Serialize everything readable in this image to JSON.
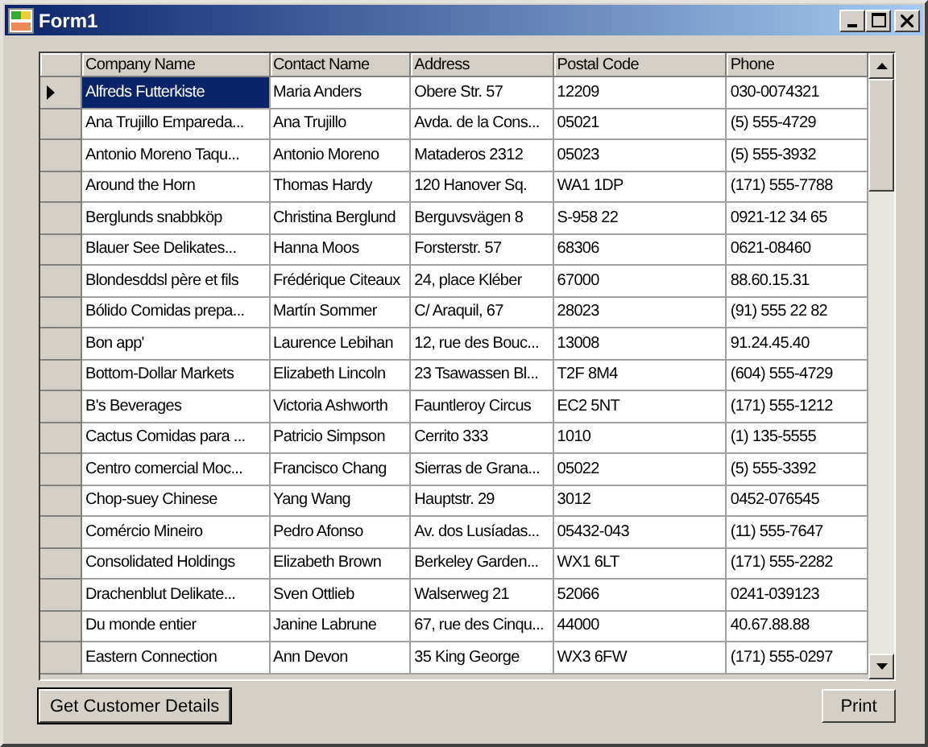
{
  "window": {
    "title": "Form1"
  },
  "table": {
    "columns": [
      "Company Name",
      "Contact Name",
      "Address",
      "Postal Code",
      "Phone"
    ],
    "rows": [
      {
        "current": true,
        "cells": [
          "Alfreds Futterkiste",
          "Maria Anders",
          "Obere Str. 57",
          "12209",
          "030-0074321"
        ]
      },
      {
        "current": false,
        "cells": [
          "Ana Trujillo Empareda...",
          "Ana Trujillo",
          "Avda. de la Cons...",
          "05021",
          "(5) 555-4729"
        ]
      },
      {
        "current": false,
        "cells": [
          "Antonio Moreno Taqu...",
          "Antonio Moreno",
          "Mataderos  2312",
          "05023",
          "(5) 555-3932"
        ]
      },
      {
        "current": false,
        "cells": [
          "Around the Horn",
          "Thomas Hardy",
          "120 Hanover Sq.",
          "WA1 1DP",
          "(171) 555-7788"
        ]
      },
      {
        "current": false,
        "cells": [
          "Berglunds snabbköp",
          "Christina Berglund",
          "Berguvsvägen  8",
          "S-958 22",
          "0921-12 34 65"
        ]
      },
      {
        "current": false,
        "cells": [
          "Blauer See Delikates...",
          "Hanna Moos",
          "Forsterstr. 57",
          "68306",
          "0621-08460"
        ]
      },
      {
        "current": false,
        "cells": [
          "Blondesddsl père et fils",
          "Frédérique Citeaux",
          "24, place Kléber",
          "67000",
          "88.60.15.31"
        ]
      },
      {
        "current": false,
        "cells": [
          "Bólido Comidas prepa...",
          "Martín Sommer",
          "C/ Araquil, 67",
          "28023",
          "(91) 555 22 82"
        ]
      },
      {
        "current": false,
        "cells": [
          "Bon app'",
          "Laurence Lebihan",
          "12, rue des Bouc...",
          "13008",
          "91.24.45.40"
        ]
      },
      {
        "current": false,
        "cells": [
          "Bottom-Dollar Markets",
          "Elizabeth Lincoln",
          "23 Tsawassen Bl...",
          "T2F 8M4",
          "(604) 555-4729"
        ]
      },
      {
        "current": false,
        "cells": [
          "B's Beverages",
          "Victoria Ashworth",
          "Fauntleroy Circus",
          "EC2 5NT",
          "(171) 555-1212"
        ]
      },
      {
        "current": false,
        "cells": [
          "Cactus Comidas para ...",
          "Patricio Simpson",
          "Cerrito 333",
          "1010",
          "(1) 135-5555"
        ]
      },
      {
        "current": false,
        "cells": [
          "Centro comercial Moc...",
          "Francisco Chang",
          "Sierras de Grana...",
          "05022",
          "(5) 555-3392"
        ]
      },
      {
        "current": false,
        "cells": [
          "Chop-suey Chinese",
          "Yang Wang",
          "Hauptstr. 29",
          "3012",
          "0452-076545"
        ]
      },
      {
        "current": false,
        "cells": [
          "Comércio Mineiro",
          "Pedro Afonso",
          "Av. dos Lusíadas...",
          "05432-043",
          "(11) 555-7647"
        ]
      },
      {
        "current": false,
        "cells": [
          "Consolidated Holdings",
          "Elizabeth Brown",
          "Berkeley Garden...",
          "WX1 6LT",
          "(171) 555-2282"
        ]
      },
      {
        "current": false,
        "cells": [
          "Drachenblut Delikate...",
          "Sven Ottlieb",
          "Walserweg 21",
          "52066",
          "0241-039123"
        ]
      },
      {
        "current": false,
        "cells": [
          "Du monde entier",
          "Janine Labrune",
          "67, rue des Cinqu...",
          "44000",
          "40.67.88.88"
        ]
      },
      {
        "current": false,
        "cells": [
          "Eastern Connection",
          "Ann Devon",
          "35 King George",
          "WX3 6FW",
          "(171) 555-0297"
        ]
      }
    ]
  },
  "buttons": {
    "primary": "Get Customer Details",
    "secondary": "Print"
  }
}
